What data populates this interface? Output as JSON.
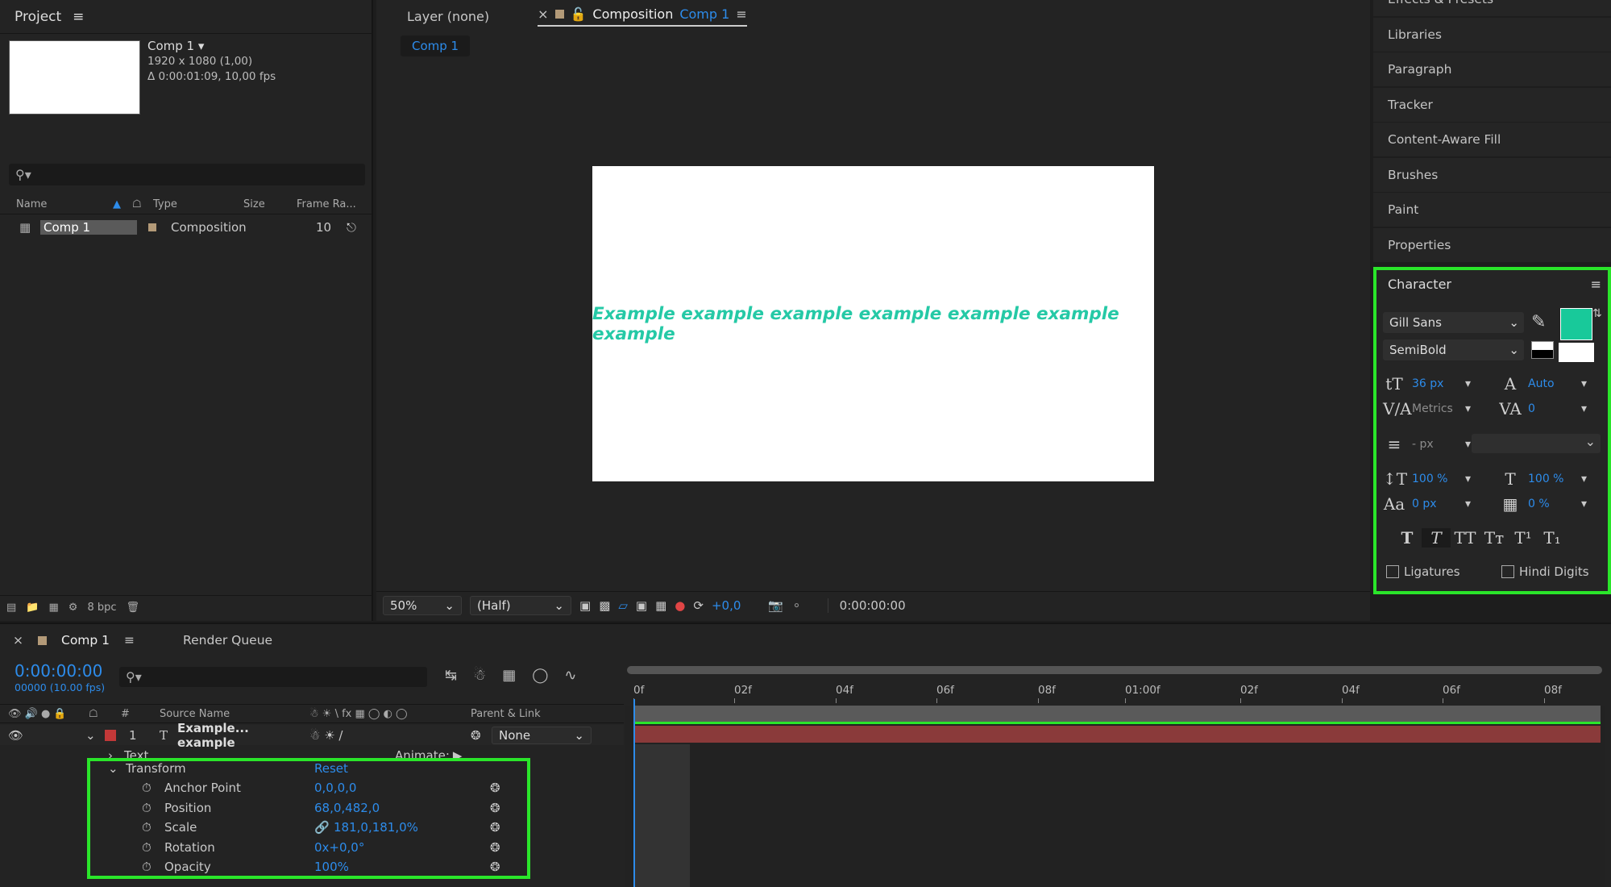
{
  "project": {
    "title": "Project",
    "comp_name": "Comp 1 ▾",
    "comp_resolution": "1920 x 1080 (1,00)",
    "comp_duration": "Δ 0:00:01:09, 10,00 fps",
    "columns": [
      "Name",
      "Type",
      "Size",
      "Frame Ra..."
    ],
    "item": {
      "name": "Comp 1",
      "type": "Composition",
      "frame_rate": "10"
    },
    "bpc": "8 bpc"
  },
  "viewer": {
    "tab_layer": "Layer (none)",
    "tab_comp_prefix": "Composition",
    "tab_comp_name": "Comp 1",
    "subtab": "Comp 1",
    "canvas_text": "Example example example example example example example",
    "canvas_text_color": "#25c9a6",
    "zoom": "50%",
    "resolution": "(Half)",
    "exposure": "+0,0",
    "timecode": "0:00:00:00"
  },
  "right_panels": [
    "Effects & Presets",
    "Libraries",
    "Paragraph",
    "Tracker",
    "Content-Aware Fill",
    "Brushes",
    "Paint",
    "Properties"
  ],
  "character": {
    "title": "Character",
    "font_family": "Gill Sans",
    "font_style": "SemiBold",
    "fill_color": "#18c99a",
    "font_size": "36 px",
    "leading": "Auto",
    "kerning": "Metrics",
    "tracking": "0",
    "stroke_width": "- px",
    "vert_scale": "100 %",
    "horiz_scale": "100 %",
    "baseline_shift": "0 px",
    "tsume": "0 %",
    "ligatures": "Ligatures",
    "hindi_digits": "Hindi Digits"
  },
  "timeline": {
    "tab": "Comp 1",
    "render_queue": "Render Queue",
    "timecode": "0:00:00:00",
    "timecode_sub": "00000 (10.00 fps)",
    "ruler": [
      "0f",
      "02f",
      "04f",
      "06f",
      "08f",
      "01:00f",
      "02f",
      "04f",
      "06f",
      "08f"
    ],
    "col_num": "#",
    "col_source": "Source Name",
    "col_parent": "Parent & Link",
    "layer_num": "1",
    "layer_name": "Example... example",
    "parent_value": "None",
    "text_group": "Text",
    "animate_label": "Animate:",
    "transform_group": "Transform",
    "reset_label": "Reset",
    "properties": [
      {
        "name": "Anchor Point",
        "value": "0,0,0,0"
      },
      {
        "name": "Position",
        "value": "68,0,482,0"
      },
      {
        "name": "Scale",
        "value": "181,0,181,0%"
      },
      {
        "name": "Rotation",
        "value": "0x+0,0°"
      },
      {
        "name": "Opacity",
        "value": "100%"
      }
    ]
  }
}
